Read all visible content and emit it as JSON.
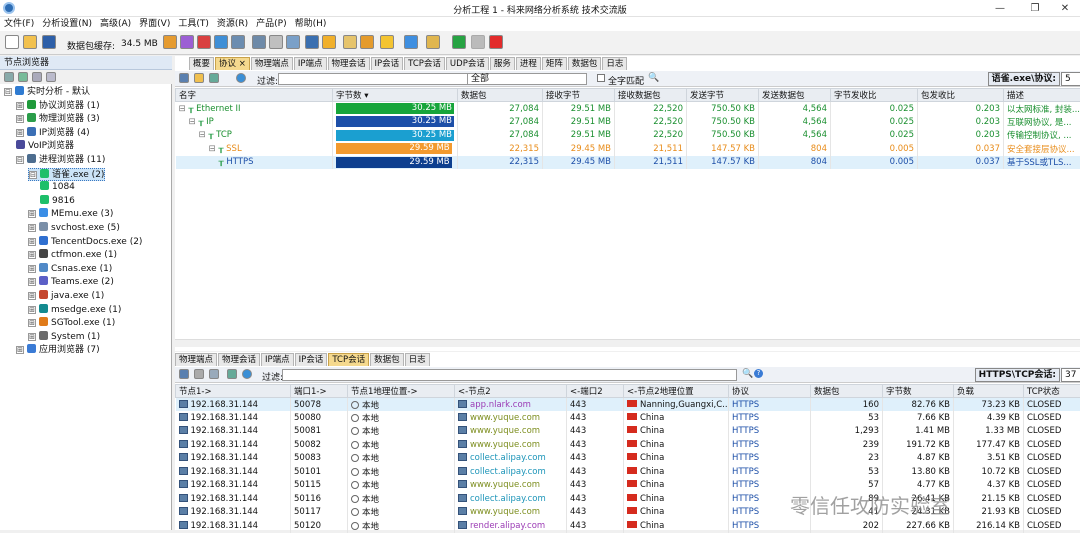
{
  "window": {
    "title": "分析工程 1 - 科来网络分析系统 技术交流版",
    "min": "—",
    "max": "❐",
    "close": "✕"
  },
  "menu": [
    "文件(F)",
    "分析设置(N)",
    "高级(A)",
    "界面(V)",
    "工具(T)",
    "资源(R)",
    "产品(P)",
    "帮助(H)"
  ],
  "toolbar": {
    "cache_label": "数据包缓存:",
    "cache_value": "34.5 MB"
  },
  "left_panel": {
    "title": "节点浏览器",
    "tree": [
      {
        "label": "实时分析 - 默认",
        "level": 0,
        "expander": "⊟",
        "color": "#2f7bd1"
      },
      {
        "label": "协议浏览器 (1)",
        "level": 1,
        "expander": "⊞",
        "color": "#1f9a3b"
      },
      {
        "label": "物理浏览器 (3)",
        "level": 1,
        "expander": "⊞",
        "color": "#2a9d4a"
      },
      {
        "label": "IP浏览器 (4)",
        "level": 1,
        "expander": "⊞",
        "color": "#3b6fb5"
      },
      {
        "label": "VoIP浏览器",
        "level": 1,
        "expander": "",
        "color": "#4a4a9a"
      },
      {
        "label": "进程浏览器 (11)",
        "level": 1,
        "expander": "⊟",
        "color": "#4d6d8f"
      },
      {
        "label": "语雀.exe (2)",
        "level": 2,
        "expander": "⊟",
        "color": "#1dbf6a",
        "selected": true
      },
      {
        "label": "1084",
        "level": 3,
        "expander": "",
        "color": "#1dbf6a"
      },
      {
        "label": "9816",
        "level": 3,
        "expander": "",
        "color": "#1dbf6a"
      },
      {
        "label": "MEmu.exe (3)",
        "level": 2,
        "expander": "⊞",
        "color": "#3a8ee6"
      },
      {
        "label": "svchost.exe (5)",
        "level": 2,
        "expander": "⊞",
        "color": "#7a8fa8"
      },
      {
        "label": "TencentDocs.exe (2)",
        "level": 2,
        "expander": "⊞",
        "color": "#2f6fd0"
      },
      {
        "label": "ctfmon.exe (1)",
        "level": 2,
        "expander": "⊞",
        "color": "#444"
      },
      {
        "label": "Csnas.exe (1)",
        "level": 2,
        "expander": "⊞",
        "color": "#5089c7"
      },
      {
        "label": "Teams.exe (2)",
        "level": 2,
        "expander": "⊞",
        "color": "#5b5fc7"
      },
      {
        "label": "java.exe (1)",
        "level": 2,
        "expander": "⊞",
        "color": "#c5472f"
      },
      {
        "label": "msedge.exe (1)",
        "level": 2,
        "expander": "⊞",
        "color": "#138a8f"
      },
      {
        "label": "SGTool.exe (1)",
        "level": 2,
        "expander": "⊞",
        "color": "#e07b1a"
      },
      {
        "label": "System (1)",
        "level": 2,
        "expander": "⊞",
        "color": "#6b6b6b"
      },
      {
        "label": "应用浏览器 (7)",
        "level": 1,
        "expander": "⊞",
        "color": "#3a7bd5"
      }
    ]
  },
  "upper": {
    "tabs": [
      "概要",
      "协议 ×",
      "物理端点",
      "IP端点",
      "物理会话",
      "IP会话",
      "TCP会话",
      "UDP会话",
      "服务",
      "进程",
      "矩阵",
      "数据包",
      "日志"
    ],
    "active_tab": 1,
    "filter_label": "过滤:",
    "filter_scope": "全部",
    "match_label": "全字匹配",
    "summary_label": "语雀.exe\\协议:",
    "summary_value": "5",
    "columns": [
      "名字",
      "字节数 ▾",
      "数据包",
      "接收字节",
      "接收数据包",
      "发送字节",
      "发送数据包",
      "字节发收比",
      "包发收比",
      "描述"
    ],
    "rows": [
      {
        "name": "Ethernet II",
        "indent": 0,
        "bytes": "30.25 MB",
        "bar_pct": 100,
        "bar_color": "#17a53a",
        "packets": "27,084",
        "rx_bytes": "29.51 MB",
        "rx_pkts": "22,520",
        "tx_bytes": "750.50 KB",
        "tx_pkts": "4,564",
        "b_ratio": "0.025",
        "p_ratio": "0.203",
        "desc": "以太网标准, 封装...",
        "color": "#1a8f2f"
      },
      {
        "name": "IP",
        "indent": 1,
        "bytes": "30.25 MB",
        "bar_pct": 100,
        "bar_color": "#1d4fa8",
        "packets": "27,084",
        "rx_bytes": "29.51 MB",
        "rx_pkts": "22,520",
        "tx_bytes": "750.50 KB",
        "tx_pkts": "4,564",
        "b_ratio": "0.025",
        "p_ratio": "0.203",
        "desc": "互联网协议, 是...",
        "color": "#1a8f2f"
      },
      {
        "name": "TCP",
        "indent": 2,
        "bytes": "30.25 MB",
        "bar_pct": 100,
        "bar_color": "#1b9fd0",
        "packets": "27,084",
        "rx_bytes": "29.51 MB",
        "rx_pkts": "22,520",
        "tx_bytes": "750.50 KB",
        "tx_pkts": "4,564",
        "b_ratio": "0.025",
        "p_ratio": "0.203",
        "desc": "传输控制协议, ...",
        "color": "#1a8f2f"
      },
      {
        "name": "SSL",
        "indent": 3,
        "bytes": "29.59 MB",
        "bar_pct": 98,
        "bar_color": "#f39a2e",
        "packets": "22,315",
        "rx_bytes": "29.45 MB",
        "rx_pkts": "21,511",
        "tx_bytes": "147.57 KB",
        "tx_pkts": "804",
        "b_ratio": "0.005",
        "p_ratio": "0.037",
        "desc": "安全套接层协议...",
        "color": "#e88c1a"
      },
      {
        "name": "HTTPS",
        "indent": 4,
        "bytes": "29.59 MB",
        "bar_pct": 98,
        "bar_color": "#0d3f8f",
        "packets": "22,315",
        "rx_bytes": "29.45 MB",
        "rx_pkts": "21,511",
        "tx_bytes": "147.57 KB",
        "tx_pkts": "804",
        "b_ratio": "0.005",
        "p_ratio": "0.037",
        "desc": "基于SSL或TLS...",
        "color": "#1d4fa8",
        "highlight": true
      }
    ]
  },
  "lower": {
    "tabs": [
      "物理端点",
      "物理会话",
      "IP端点",
      "IP会话",
      "TCP会话",
      "数据包",
      "日志"
    ],
    "active_tab": 4,
    "filter_label": "过滤:",
    "summary_label": "HTTPS\\TCP会话:",
    "summary_value": "37",
    "columns": [
      "节点1->",
      "端口1->",
      "节点1地理位置->",
      "<-节点2",
      "<-端口2",
      "<-节点2地理位置",
      "协议",
      "数据包",
      "字节数",
      "负载",
      "TCP状态"
    ],
    "rows": [
      {
        "n1": "192.168.31.144",
        "p1": "50078",
        "g1": "本地",
        "n2": "app.nlark.com",
        "p2": "443",
        "g2": "Nanning,Guangxi,C...",
        "proto": "HTTPS",
        "pk": "160",
        "by": "82.76 KB",
        "ld": "73.23 KB",
        "st": "CLOSED",
        "n2c": "#9b3bb5"
      },
      {
        "n1": "192.168.31.144",
        "p1": "50080",
        "g1": "本地",
        "n2": "www.yuque.com",
        "p2": "443",
        "g2": "China",
        "proto": "HTTPS",
        "pk": "53",
        "by": "7.66 KB",
        "ld": "4.39 KB",
        "st": "CLOSED",
        "n2c": "#7d8e1f"
      },
      {
        "n1": "192.168.31.144",
        "p1": "50081",
        "g1": "本地",
        "n2": "www.yuque.com",
        "p2": "443",
        "g2": "China",
        "proto": "HTTPS",
        "pk": "1,293",
        "by": "1.41 MB",
        "ld": "1.33 MB",
        "st": "CLOSED",
        "n2c": "#7d8e1f"
      },
      {
        "n1": "192.168.31.144",
        "p1": "50082",
        "g1": "本地",
        "n2": "www.yuque.com",
        "p2": "443",
        "g2": "China",
        "proto": "HTTPS",
        "pk": "239",
        "by": "191.72 KB",
        "ld": "177.47 KB",
        "st": "CLOSED",
        "n2c": "#7d8e1f"
      },
      {
        "n1": "192.168.31.144",
        "p1": "50083",
        "g1": "本地",
        "n2": "collect.alipay.com",
        "p2": "443",
        "g2": "China",
        "proto": "HTTPS",
        "pk": "23",
        "by": "4.87 KB",
        "ld": "3.51 KB",
        "st": "CLOSED",
        "n2c": "#1b94b8"
      },
      {
        "n1": "192.168.31.144",
        "p1": "50101",
        "g1": "本地",
        "n2": "collect.alipay.com",
        "p2": "443",
        "g2": "China",
        "proto": "HTTPS",
        "pk": "53",
        "by": "13.80 KB",
        "ld": "10.72 KB",
        "st": "CLOSED",
        "n2c": "#1b94b8"
      },
      {
        "n1": "192.168.31.144",
        "p1": "50115",
        "g1": "本地",
        "n2": "www.yuque.com",
        "p2": "443",
        "g2": "China",
        "proto": "HTTPS",
        "pk": "57",
        "by": "4.77 KB",
        "ld": "4.37 KB",
        "st": "CLOSED",
        "n2c": "#7d8e1f"
      },
      {
        "n1": "192.168.31.144",
        "p1": "50116",
        "g1": "本地",
        "n2": "collect.alipay.com",
        "p2": "443",
        "g2": "China",
        "proto": "HTTPS",
        "pk": "89",
        "by": "26.41 KB",
        "ld": "21.15 KB",
        "st": "CLOSED",
        "n2c": "#1b94b8"
      },
      {
        "n1": "192.168.31.144",
        "p1": "50117",
        "g1": "本地",
        "n2": "www.yuque.com",
        "p2": "443",
        "g2": "China",
        "proto": "HTTPS",
        "pk": "41",
        "by": "24.31 KB",
        "ld": "21.93 KB",
        "st": "CLOSED",
        "n2c": "#7d8e1f"
      },
      {
        "n1": "192.168.31.144",
        "p1": "50120",
        "g1": "本地",
        "n2": "render.alipay.com",
        "p2": "443",
        "g2": "China",
        "proto": "HTTPS",
        "pk": "202",
        "by": "227.66 KB",
        "ld": "216.14 KB",
        "st": "CLOSED",
        "n2c": "#9b3bb5"
      }
    ]
  },
  "watermark": "零信任攻防实验室"
}
